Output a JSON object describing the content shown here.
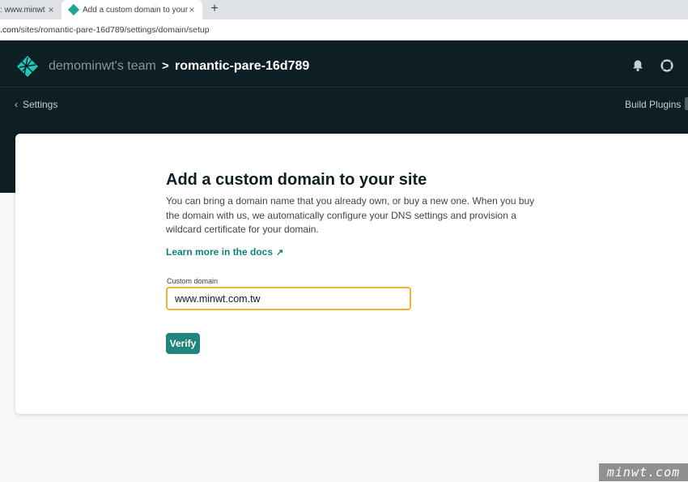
{
  "browser": {
    "tabs": [
      {
        "title": ": www.minwt",
        "close": "×"
      },
      {
        "title": "Add a custom domain to your site",
        "close": "×"
      }
    ],
    "new_tab": "+",
    "url_prefix": ".com",
    "url_path": "/sites/romantic-pare-16d789/settings/domain/setup"
  },
  "header": {
    "team": "demominwt's team",
    "separator": ">",
    "site": "romantic-pare-16d789",
    "back_label": "Settings",
    "right_link": "Build Plugins"
  },
  "setup": {
    "title": "Add a custom domain to your site",
    "description": "You can bring a domain name that you already own, or buy a new one. When you buy the domain with us, we automatically configure your DNS settings and provision a wildcard certificate for your domain.",
    "docs_link": "Learn more in the docs",
    "docs_arrow": "↗",
    "field_label": "Custom domain",
    "field_value": "www.minwt.com.tw",
    "verify_label": "Verify"
  },
  "watermark": "minwt.com",
  "colors": {
    "header_bg": "#0e1e25",
    "accent": "#20857a",
    "link": "#128373",
    "focus": "#f2b32e"
  }
}
